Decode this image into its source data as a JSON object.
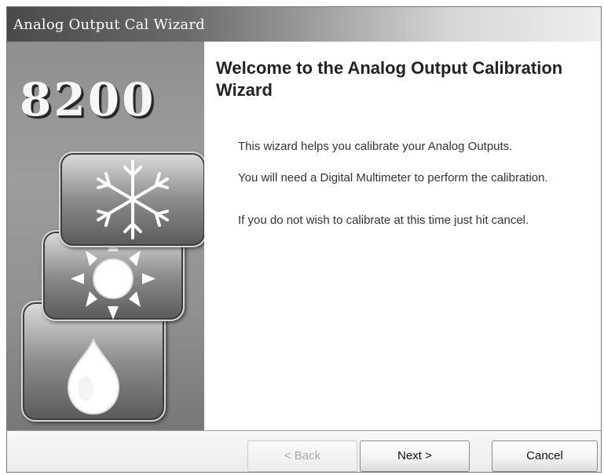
{
  "window": {
    "title": "Analog Output Cal Wizard"
  },
  "sidebar": {
    "model_number": "8200",
    "icons": [
      "snowflake-icon",
      "sun-icon",
      "drop-icon"
    ]
  },
  "content": {
    "heading": "Welcome to the Analog Output Calibration Wizard",
    "paragraphs": [
      "This wizard helps you calibrate your Analog Outputs.",
      "You will need a Digital Multimeter to perform the calibration.",
      "If you do not wish to calibrate at this time just hit cancel."
    ]
  },
  "buttons": {
    "back": "< Back",
    "next": "Next >",
    "cancel": "Cancel"
  },
  "colors": {
    "sidebar_gray": "#8f8f8f",
    "titlebar_dark": "#4a4a4a"
  }
}
